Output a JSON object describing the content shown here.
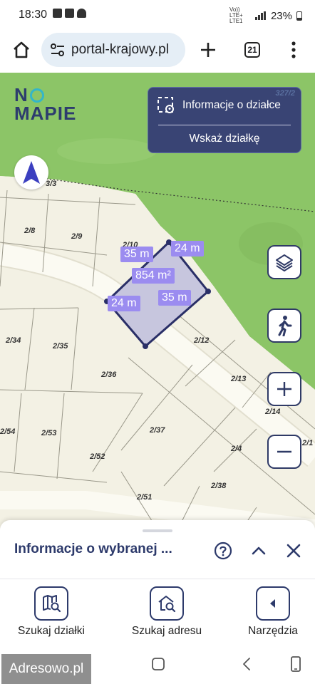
{
  "status_bar": {
    "time": "18:30",
    "network": "Vo)) LTE+ LTE1",
    "battery": "23%"
  },
  "browser": {
    "url": "portal-krajowy.pl",
    "tab_count": "21"
  },
  "map": {
    "logo_line1": "N",
    "logo_line2": "MAPIE",
    "info_panel": {
      "parcel_info_label": "Informacje o działce",
      "show_parcel_label": "Wskaż działkę",
      "corner_label": "327/2"
    },
    "selected_parcel": {
      "area": "854 m²",
      "side_top_left": "35 m",
      "side_top_right": "24 m",
      "side_bottom_left": "24 m",
      "side_bottom_right": "35 m"
    },
    "parcel_labels": [
      "3/3",
      "2/8",
      "2/9",
      "2/10",
      "2/34",
      "2/35",
      "2/36",
      "2/12",
      "2/13",
      "2/14",
      "2/54",
      "2/53",
      "2/52",
      "2/37",
      "2/4",
      "2/1",
      "2/38",
      "2/51"
    ]
  },
  "bottom_sheet": {
    "title": "Informacje o wybranej ..."
  },
  "bottom_nav": {
    "search_parcel": "Szukaj działki",
    "search_address": "Szukaj adresu",
    "tools": "Narzędzia"
  },
  "watermark": "Adresowo.pl",
  "colors": {
    "brand_navy": "#2d3a6b",
    "panel_bg": "#394474",
    "forest": "#8cc567",
    "parcel_fill": "#c7c6de",
    "dimension_tag": "#9b8cf0",
    "map_base": "#f3f1e4"
  }
}
